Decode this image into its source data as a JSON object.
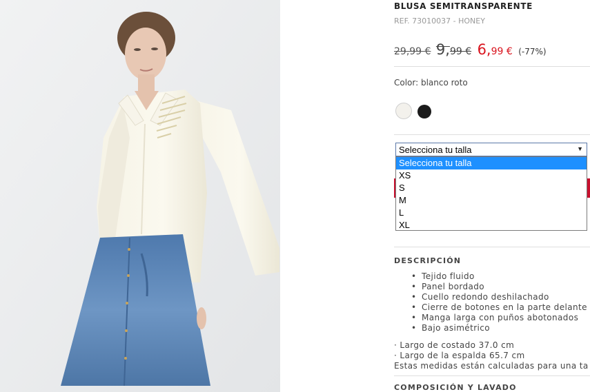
{
  "product": {
    "title": "BLUSA SEMITRANSPARENTE",
    "ref": "REF. 73010037 - HONEY",
    "price_original": "29,99 €",
    "price_previous_int": "9,",
    "price_previous_dec": "99 €",
    "price_sale_int": "6,",
    "price_sale_dec": "99 €",
    "discount": "(-77%)"
  },
  "color": {
    "label": "Color: blanco roto",
    "swatches": [
      "#f3f1ec",
      "#1b1b1b"
    ]
  },
  "size_select": {
    "selected": "Selecciona tu talla",
    "options": [
      "Selecciona tu talla",
      "XS",
      "S",
      "M",
      "L",
      "XL"
    ]
  },
  "description": {
    "heading": "DESCRIPCIÓN",
    "features": [
      "Tejido fluido",
      "Panel bordado",
      "Cuello redondo deshilachado",
      "Cierre de botones en la parte delante",
      "Manga larga con puños abotonados",
      "Bajo asimétrico"
    ],
    "measures": [
      "· Largo de costado 37.0 cm",
      "· Largo de la espalda 65.7 cm",
      "Estas medidas están calculadas para una ta"
    ]
  },
  "composition": {
    "heading": "COMPOSICIÓN Y LAVADO"
  },
  "colors": {
    "sale_red": "#d9141e",
    "cart_red": "#c8102e",
    "highlight": "#1e90ff"
  }
}
